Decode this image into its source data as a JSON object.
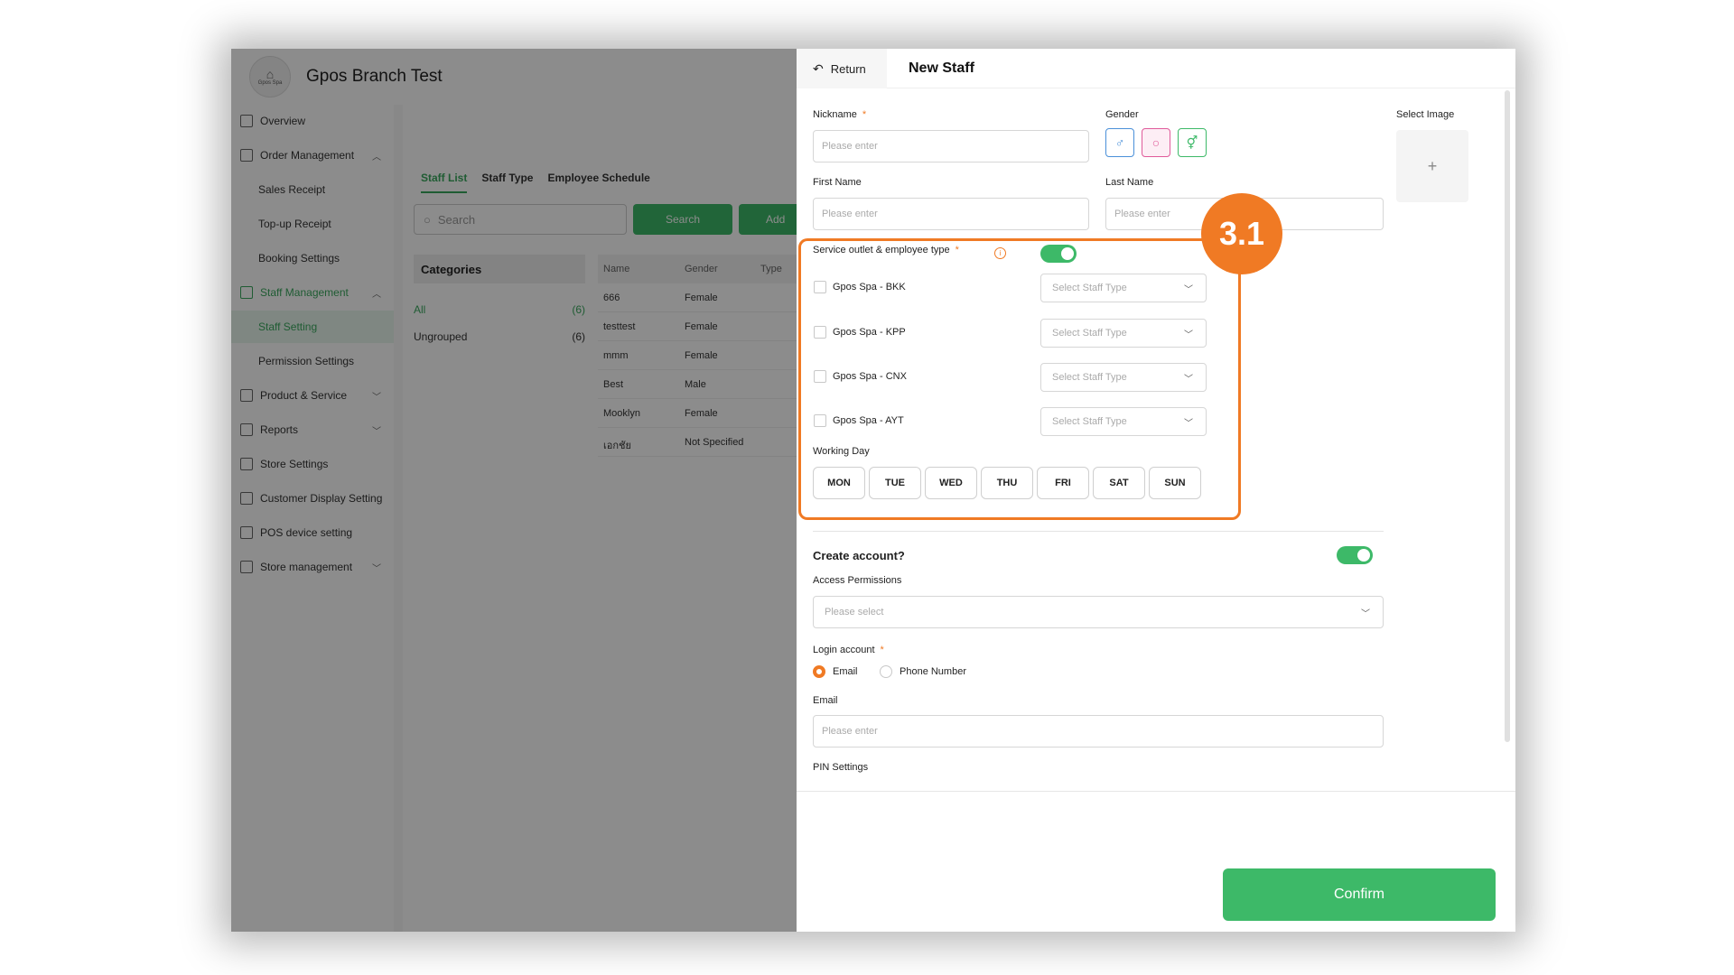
{
  "app": {
    "title": "Gpos Branch Test",
    "logo_text": "Gpos Spa",
    "sidebar": {
      "items": [
        {
          "label": "Overview",
          "icon": "overview-icon"
        },
        {
          "label": "Order Management",
          "icon": "order-icon"
        },
        {
          "label": "Sales Receipt"
        },
        {
          "label": "Top-up Receipt"
        },
        {
          "label": "Booking Settings"
        },
        {
          "label": "Staff Management",
          "icon": "staff-icon"
        },
        {
          "label": "Staff Setting"
        },
        {
          "label": "Permission Settings"
        },
        {
          "label": "Product & Service",
          "icon": "product-icon"
        },
        {
          "label": "Reports",
          "icon": "reports-icon"
        },
        {
          "label": "Store Settings",
          "icon": "store-icon"
        },
        {
          "label": "Customer Display Setting",
          "icon": "display-icon"
        },
        {
          "label": "POS device setting",
          "icon": "pos-icon"
        },
        {
          "label": "Store management",
          "icon": "store-mgmt-icon"
        }
      ]
    },
    "tabs": [
      "Staff List",
      "Staff Type",
      "Employee Schedule"
    ],
    "search_placeholder": "Search",
    "search_button": "Search",
    "add_button": "Add",
    "categories": {
      "title": "Categories",
      "rows": [
        {
          "label": "All",
          "count": "(6)"
        },
        {
          "label": "Ungrouped",
          "count": "(6)"
        }
      ]
    },
    "table": {
      "headers": [
        "Name",
        "Gender",
        "Type"
      ],
      "rows": [
        [
          "666",
          "Female"
        ],
        [
          "testtest",
          "Female"
        ],
        [
          "mmm",
          "Female"
        ],
        [
          "Best",
          "Male"
        ],
        [
          "Mooklyn",
          "Female"
        ],
        [
          "เอกชัย",
          "Not Specified"
        ]
      ]
    }
  },
  "drawer": {
    "return_label": "Return",
    "title": "New Staff",
    "nickname": {
      "label": "Nickname",
      "required": "*",
      "placeholder": "Please enter"
    },
    "gender": {
      "label": "Gender",
      "options": [
        "male-icon",
        "female-icon",
        "other-gender-icon"
      ]
    },
    "select_image": {
      "label": "Select Image",
      "plus": "+"
    },
    "first_name": {
      "label": "First Name",
      "placeholder": "Please enter"
    },
    "last_name": {
      "label": "Last Name",
      "placeholder": "Please enter"
    },
    "service_outlet": {
      "label": "Service outlet & employee type",
      "required": "*",
      "info": "i",
      "toggle_on": true,
      "outlets": [
        {
          "name": "Gpos Spa - BKK",
          "select": "Select Staff Type"
        },
        {
          "name": "Gpos Spa - KPP",
          "select": "Select Staff Type"
        },
        {
          "name": "Gpos Spa - CNX",
          "select": "Select Staff Type"
        },
        {
          "name": "Gpos Spa - AYT",
          "select": "Select Staff Type"
        }
      ]
    },
    "working_day": {
      "label": "Working Day",
      "days": [
        "MON",
        "TUE",
        "WED",
        "THU",
        "FRI",
        "SAT",
        "SUN"
      ]
    },
    "create_account": {
      "label": "Create account?",
      "toggle_on": true
    },
    "access_permissions": {
      "label": "Access Permissions",
      "placeholder": "Please select"
    },
    "login_account": {
      "label": "Login account",
      "required": "*",
      "options": [
        {
          "label": "Email",
          "selected": true
        },
        {
          "label": "Phone Number",
          "selected": false
        }
      ]
    },
    "email": {
      "label": "Email",
      "placeholder": "Please enter"
    },
    "pin_settings": {
      "label": "PIN Settings"
    },
    "confirm": "Confirm"
  },
  "annotation": {
    "step": "3.1",
    "color": "#f07a24"
  },
  "colors": {
    "accent": "#3db968",
    "highlight": "#f07a24"
  }
}
